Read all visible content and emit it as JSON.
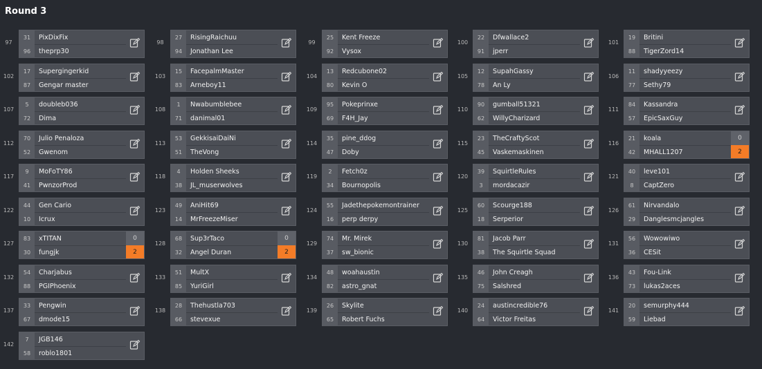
{
  "round_title": "Round 3",
  "colors": {
    "background": "#272a30",
    "card": "#4b4e55",
    "winner_score": "#f47c27"
  },
  "columns": [
    [
      {
        "num": "97",
        "p1": {
          "seed": "31",
          "name": "PixDixFix"
        },
        "p2": {
          "seed": "96",
          "name": "theprp30"
        }
      },
      {
        "num": "102",
        "p1": {
          "seed": "17",
          "name": "Supergingerkid"
        },
        "p2": {
          "seed": "87",
          "name": "Gengar master"
        }
      },
      {
        "num": "107",
        "p1": {
          "seed": "5",
          "name": "doubleb036"
        },
        "p2": {
          "seed": "72",
          "name": "Dima"
        }
      },
      {
        "num": "112",
        "p1": {
          "seed": "70",
          "name": "Julio Penaloza"
        },
        "p2": {
          "seed": "52",
          "name": "Gwenom"
        }
      },
      {
        "num": "117",
        "p1": {
          "seed": "9",
          "name": "MoFoTY86"
        },
        "p2": {
          "seed": "41",
          "name": "PwnzorProd"
        }
      },
      {
        "num": "122",
        "p1": {
          "seed": "44",
          "name": "Gen Cario"
        },
        "p2": {
          "seed": "10",
          "name": "Icrux"
        }
      },
      {
        "num": "127",
        "p1": {
          "seed": "83",
          "name": "xTITAN",
          "score": "0"
        },
        "p2": {
          "seed": "30",
          "name": "fungjk",
          "score": "2"
        }
      },
      {
        "num": "132",
        "p1": {
          "seed": "54",
          "name": "Charjabus"
        },
        "p2": {
          "seed": "88",
          "name": "PGIPhoenix"
        }
      },
      {
        "num": "137",
        "p1": {
          "seed": "33",
          "name": "Pengwin"
        },
        "p2": {
          "seed": "67",
          "name": "dmode15"
        }
      },
      {
        "num": "142",
        "p1": {
          "seed": "7",
          "name": "JGB146"
        },
        "p2": {
          "seed": "58",
          "name": "roblo1801"
        }
      }
    ],
    [
      {
        "num": "98",
        "p1": {
          "seed": "27",
          "name": "RisingRaichuu"
        },
        "p2": {
          "seed": "94",
          "name": "Jonathan Lee"
        }
      },
      {
        "num": "103",
        "p1": {
          "seed": "15",
          "name": "FacepalmMaster"
        },
        "p2": {
          "seed": "83",
          "name": "Arneboy11"
        }
      },
      {
        "num": "108",
        "p1": {
          "seed": "1",
          "name": "Nwabumblebee"
        },
        "p2": {
          "seed": "71",
          "name": "danimal01"
        }
      },
      {
        "num": "113",
        "p1": {
          "seed": "53",
          "name": "GekkisaiDaiNi"
        },
        "p2": {
          "seed": "51",
          "name": "TheVong"
        }
      },
      {
        "num": "118",
        "p1": {
          "seed": "4",
          "name": "Holden Sheeks"
        },
        "p2": {
          "seed": "38",
          "name": "JL_muserwolves"
        }
      },
      {
        "num": "123",
        "p1": {
          "seed": "49",
          "name": "AniHit69"
        },
        "p2": {
          "seed": "14",
          "name": "MrFreezeMiser"
        }
      },
      {
        "num": "128",
        "p1": {
          "seed": "68",
          "name": "Sup3rTaco",
          "score": "0"
        },
        "p2": {
          "seed": "32",
          "name": "Angel Duran",
          "score": "2"
        }
      },
      {
        "num": "133",
        "p1": {
          "seed": "51",
          "name": "MultX"
        },
        "p2": {
          "seed": "85",
          "name": "YuriGirl"
        }
      },
      {
        "num": "138",
        "p1": {
          "seed": "28",
          "name": "Thehustla703"
        },
        "p2": {
          "seed": "66",
          "name": "stevexue"
        }
      }
    ],
    [
      {
        "num": "99",
        "p1": {
          "seed": "25",
          "name": "Kent Freeze"
        },
        "p2": {
          "seed": "92",
          "name": "Vysox"
        }
      },
      {
        "num": "104",
        "p1": {
          "seed": "13",
          "name": "Redcubone02"
        },
        "p2": {
          "seed": "80",
          "name": "Kevin O"
        }
      },
      {
        "num": "109",
        "p1": {
          "seed": "95",
          "name": "Pokeprinxe"
        },
        "p2": {
          "seed": "69",
          "name": "F4H_Jay"
        }
      },
      {
        "num": "114",
        "p1": {
          "seed": "35",
          "name": "pine_ddog"
        },
        "p2": {
          "seed": "47",
          "name": "Doby"
        }
      },
      {
        "num": "119",
        "p1": {
          "seed": "2",
          "name": "Fetch0z"
        },
        "p2": {
          "seed": "34",
          "name": "Bournopolis"
        }
      },
      {
        "num": "124",
        "p1": {
          "seed": "55",
          "name": "Jadethepokemontrainer"
        },
        "p2": {
          "seed": "16",
          "name": "perp derpy"
        }
      },
      {
        "num": "129",
        "p1": {
          "seed": "74",
          "name": "Mr. Mirek"
        },
        "p2": {
          "seed": "37",
          "name": "sw_bionic"
        }
      },
      {
        "num": "134",
        "p1": {
          "seed": "48",
          "name": "woahaustin"
        },
        "p2": {
          "seed": "82",
          "name": "astro_gnat"
        }
      },
      {
        "num": "139",
        "p1": {
          "seed": "26",
          "name": "Skylite"
        },
        "p2": {
          "seed": "65",
          "name": "Robert Fuchs"
        }
      }
    ],
    [
      {
        "num": "100",
        "p1": {
          "seed": "22",
          "name": "Dfwallace2"
        },
        "p2": {
          "seed": "91",
          "name": "jperr"
        }
      },
      {
        "num": "105",
        "p1": {
          "seed": "12",
          "name": "SupahGassy"
        },
        "p2": {
          "seed": "78",
          "name": "An Ly"
        }
      },
      {
        "num": "110",
        "p1": {
          "seed": "90",
          "name": "gumball51321"
        },
        "p2": {
          "seed": "62",
          "name": "WillyCharizard"
        }
      },
      {
        "num": "115",
        "p1": {
          "seed": "23",
          "name": "TheCraftyScot"
        },
        "p2": {
          "seed": "45",
          "name": "Vaskemaskinen"
        }
      },
      {
        "num": "120",
        "p1": {
          "seed": "39",
          "name": "SquirtleRules"
        },
        "p2": {
          "seed": "3",
          "name": "mordacazir"
        }
      },
      {
        "num": "125",
        "p1": {
          "seed": "60",
          "name": "Scourge188"
        },
        "p2": {
          "seed": "18",
          "name": "Serperior"
        }
      },
      {
        "num": "130",
        "p1": {
          "seed": "81",
          "name": "Jacob Parr"
        },
        "p2": {
          "seed": "38",
          "name": "The Squirtle Squad"
        }
      },
      {
        "num": "135",
        "p1": {
          "seed": "46",
          "name": "John Creagh"
        },
        "p2": {
          "seed": "75",
          "name": "Salshred"
        }
      },
      {
        "num": "140",
        "p1": {
          "seed": "24",
          "name": "austincredible76"
        },
        "p2": {
          "seed": "64",
          "name": "Victor Freitas"
        }
      }
    ],
    [
      {
        "num": "101",
        "p1": {
          "seed": "19",
          "name": "Britini"
        },
        "p2": {
          "seed": "88",
          "name": "TigerZord14"
        }
      },
      {
        "num": "106",
        "p1": {
          "seed": "11",
          "name": "shadyyeezy"
        },
        "p2": {
          "seed": "77",
          "name": "Sethy79"
        }
      },
      {
        "num": "111",
        "p1": {
          "seed": "84",
          "name": "Kassandra"
        },
        "p2": {
          "seed": "57",
          "name": "EpicSaxGuy"
        }
      },
      {
        "num": "116",
        "p1": {
          "seed": "21",
          "name": "koala",
          "score": "0"
        },
        "p2": {
          "seed": "42",
          "name": "MHALL1207",
          "score": "2"
        }
      },
      {
        "num": "121",
        "p1": {
          "seed": "40",
          "name": "leve101"
        },
        "p2": {
          "seed": "8",
          "name": "CaptZero"
        }
      },
      {
        "num": "126",
        "p1": {
          "seed": "61",
          "name": "Nirvandalo"
        },
        "p2": {
          "seed": "29",
          "name": "Danglesmcjangles"
        }
      },
      {
        "num": "131",
        "p1": {
          "seed": "56",
          "name": "Wowowiwo"
        },
        "p2": {
          "seed": "36",
          "name": "CESit"
        }
      },
      {
        "num": "136",
        "p1": {
          "seed": "43",
          "name": "Fou-Link"
        },
        "p2": {
          "seed": "73",
          "name": "lukas2aces"
        }
      },
      {
        "num": "141",
        "p1": {
          "seed": "20",
          "name": "semurphy444"
        },
        "p2": {
          "seed": "59",
          "name": "Liebad"
        }
      }
    ]
  ]
}
